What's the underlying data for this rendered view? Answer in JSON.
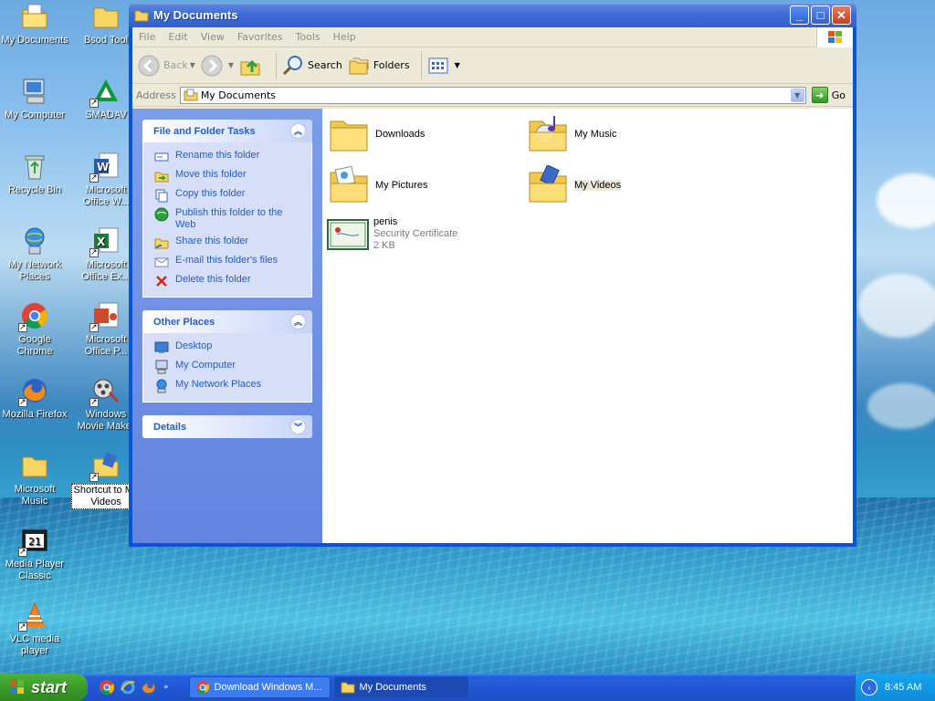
{
  "desktop": {
    "icons": [
      {
        "label": "My Documents",
        "icon": "my-documents-icon"
      },
      {
        "label": "Bsod Tools",
        "icon": "folder-icon"
      },
      {
        "label": "My Computer",
        "icon": "my-computer-icon"
      },
      {
        "label": "SMADAV",
        "icon": "smadav-icon"
      },
      {
        "label": "Recycle Bin",
        "icon": "recycle-bin-icon"
      },
      {
        "label": "Microsoft Office W...",
        "icon": "word-icon"
      },
      {
        "label": "My Network Places",
        "icon": "network-places-icon"
      },
      {
        "label": "Microsoft Office Ex...",
        "icon": "excel-icon"
      },
      {
        "label": "Google Chrome",
        "icon": "chrome-icon"
      },
      {
        "label": "Microsoft Office P...",
        "icon": "powerpoint-icon"
      },
      {
        "label": "Mozilla Firefox",
        "icon": "firefox-icon"
      },
      {
        "label": "Windows Movie Maker",
        "icon": "movie-maker-icon"
      },
      {
        "label": "Microsoft Music",
        "icon": "folder-icon"
      },
      {
        "label": "Shortcut to My Videos",
        "icon": "my-videos-shortcut-icon"
      },
      {
        "label": "Media Player Classic",
        "icon": "media-player-classic-icon"
      },
      {
        "label": "VLC media player",
        "icon": "vlc-icon"
      }
    ],
    "icon_labels_displayed": {
      "bsod": "Bsod Tool",
      "smadav": "SMADAV",
      "word": "Microsoft Office W...",
      "excel": "Microsoft Office Ex...",
      "ppt": "Microsoft Office P...",
      "moviemaker": "Windows Movie Maker",
      "shortcut_videos": "Shortcut to My Videos"
    }
  },
  "window": {
    "title": "My Documents",
    "menu": [
      "File",
      "Edit",
      "View",
      "Favorites",
      "Tools",
      "Help"
    ],
    "toolbar": {
      "back": "Back",
      "search": "Search",
      "folders": "Folders"
    },
    "address": {
      "label": "Address",
      "value": "My Documents",
      "go": "Go"
    },
    "left_panel": {
      "file_tasks": {
        "title": "File and Folder Tasks",
        "items": [
          "Rename this folder",
          "Move this folder",
          "Copy this folder",
          "Publish this folder to the Web",
          "Share this folder",
          "E-mail this folder's files",
          "Delete this folder"
        ]
      },
      "other_places": {
        "title": "Other Places",
        "items": [
          "Desktop",
          "My Computer",
          "My Network Places"
        ]
      },
      "details": {
        "title": "Details"
      }
    },
    "files": [
      {
        "name": "Downloads"
      },
      {
        "name": "My Music"
      },
      {
        "name": "My Pictures"
      },
      {
        "name": "My Videos"
      },
      {
        "name": "penis",
        "type": "Security Certificate",
        "size": "2 KB"
      }
    ]
  },
  "taskbar": {
    "start": "start",
    "tasks": [
      "Download Windows M...",
      "My Documents"
    ],
    "clock": "8:45 AM"
  },
  "colors": {
    "xp_blue": "#0a52d6",
    "link_blue": "#215dc6",
    "start_green": "#3c9b2a"
  }
}
